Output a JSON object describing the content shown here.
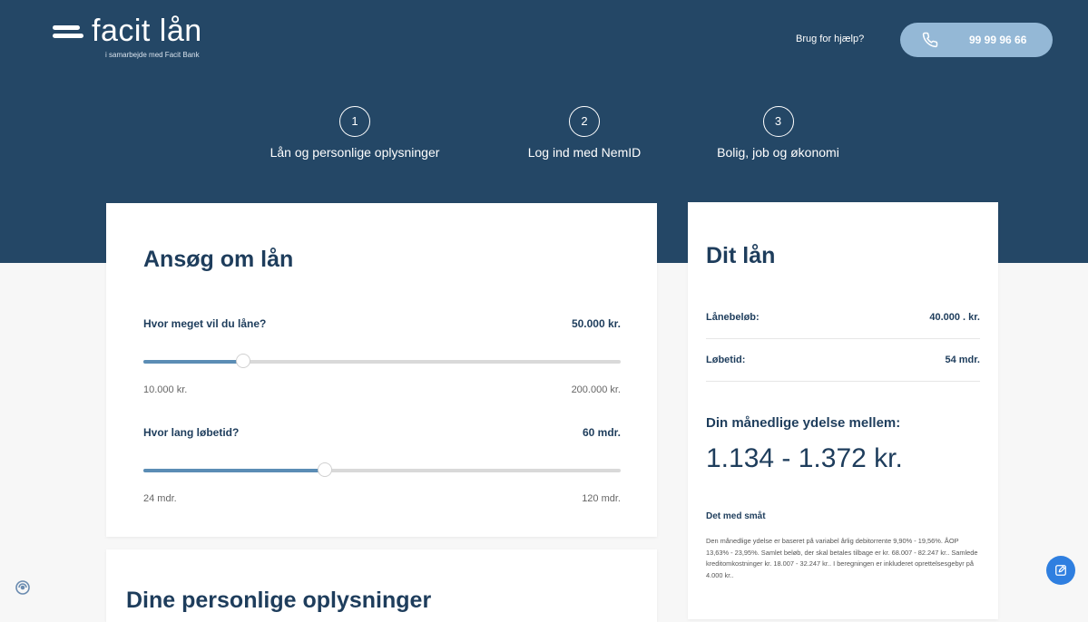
{
  "header": {
    "logo_text": "facit lån",
    "logo_sub": "i samarbejde med Facit Bank",
    "help_text": "Brug for hjælp?",
    "phone": "99 99 96 66"
  },
  "steps": [
    {
      "num": "1",
      "label": "Lån og personlige oplysninger"
    },
    {
      "num": "2",
      "label": "Log ind med NemID"
    },
    {
      "num": "3",
      "label": "Bolig, job og økonomi"
    }
  ],
  "apply": {
    "title": "Ansøg om lån",
    "amount_question": "Hvor meget vil du låne?",
    "amount_value": "50.000 kr.",
    "amount_min": "10.000 kr.",
    "amount_max": "200.000 kr.",
    "amount_fraction": 0.21,
    "term_question": "Hvor lang løbetid?",
    "term_value": "60 mdr.",
    "term_min": "24 mdr.",
    "term_max": "120 mdr.",
    "term_fraction": 0.38
  },
  "summary": {
    "title": "Dit lån",
    "loan_label": "Lånebeløb:",
    "loan_value": "40.000 . kr.",
    "term_label": "Løbetid:",
    "term_value": "54 mdr.",
    "monthly_title": "Din månedlige ydelse mellem:",
    "monthly_value": "1.134 - 1.372 kr.",
    "fine_title": "Det med småt",
    "fine_text": "Den månedlige ydelse er baseret på variabel årlig debitorrente 9,90% - 19,56%. ÅOP 13,63% - 23,95%. Samlet beløb, der skal betales tilbage er kr. 68.007 - 82.247 kr.. Samlede kreditomkostninger kr. 18.007 - 32.247 kr.. I beregningen er inkluderet oprettelsesgebyr på 4.000 kr.."
  },
  "personal": {
    "title": "Dine personlige oplysninger"
  },
  "colors": {
    "brand_navy": "#244766",
    "accent_light_blue": "#94b8d6",
    "slider_fill": "#5b8db5",
    "fab_blue": "#2f7fe0"
  }
}
